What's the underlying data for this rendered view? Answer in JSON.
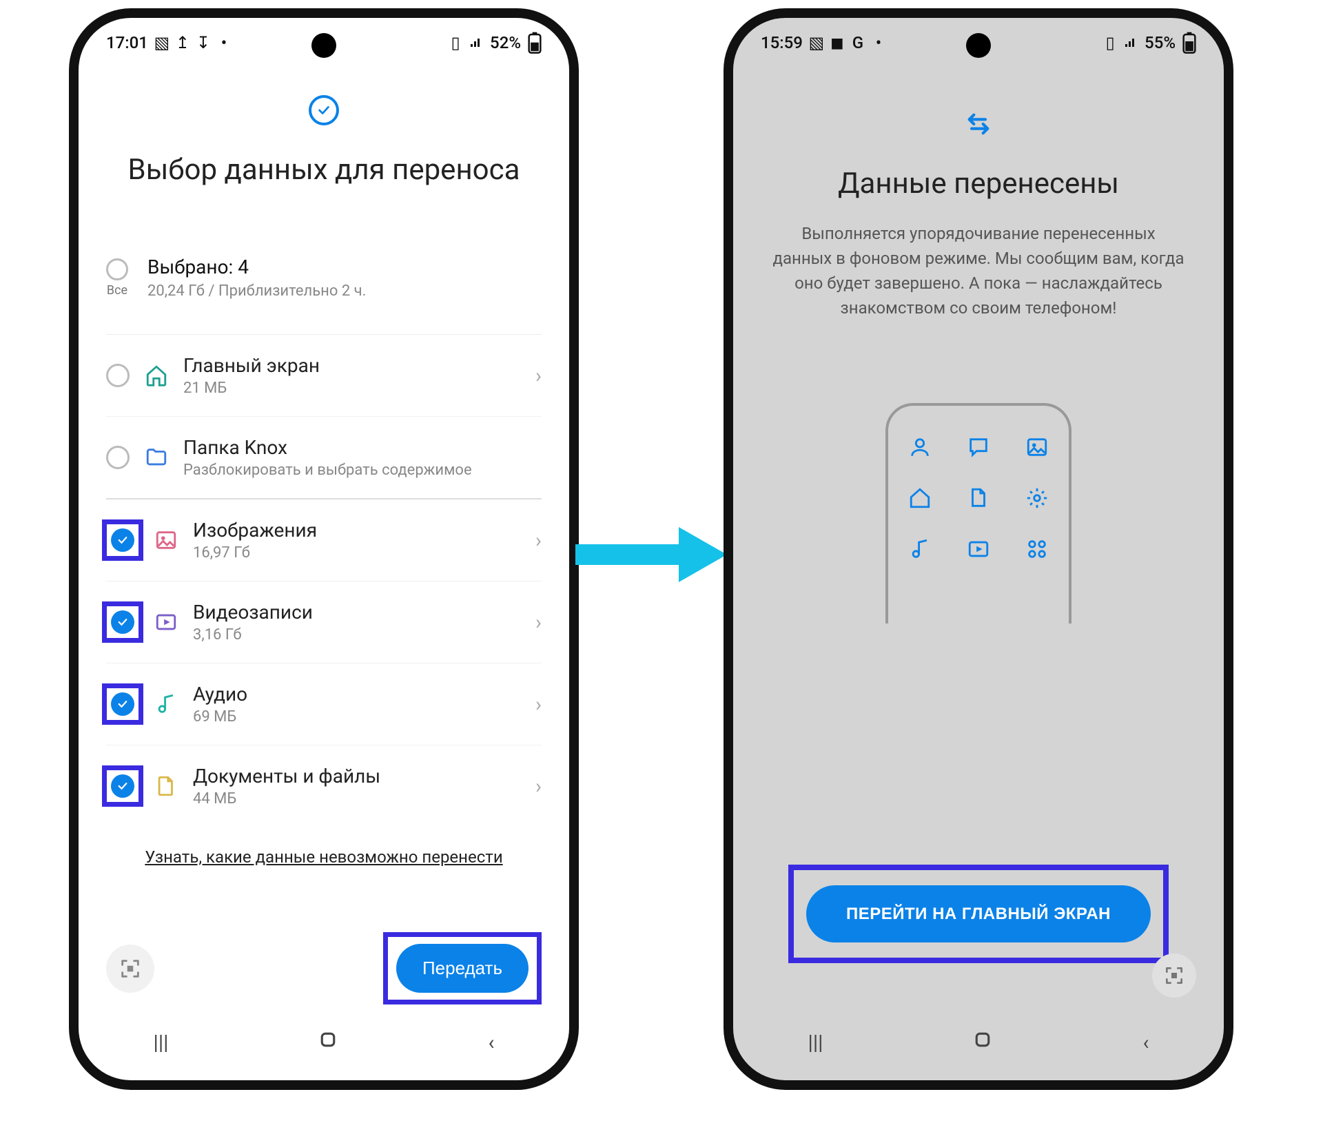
{
  "colors": {
    "accent": "#0b82e8",
    "highlight": "#3a2be0",
    "arrow": "#15c1e8"
  },
  "left": {
    "status": {
      "time": "17:01",
      "battery": "52%"
    },
    "title": "Выбор данных для переноса",
    "summary": {
      "all_label": "Все",
      "selected": "Выбрано: 4",
      "details": "20,24 Гб / Приблизительно 2 ч."
    },
    "items": [
      {
        "name": "Главный экран",
        "sub": "21 МБ",
        "checked": false,
        "highlighted": false,
        "icon": "home"
      },
      {
        "name": "Папка Knox",
        "sub": "Разблокировать и выбрать содержимое",
        "checked": false,
        "highlighted": false,
        "icon": "folder"
      },
      {
        "name": "Изображения",
        "sub": "16,97 Гб",
        "checked": true,
        "highlighted": true,
        "icon": "image"
      },
      {
        "name": "Видеозаписи",
        "sub": "3,16 Гб",
        "checked": true,
        "highlighted": true,
        "icon": "video"
      },
      {
        "name": "Аудио",
        "sub": "69 МБ",
        "checked": true,
        "highlighted": true,
        "icon": "audio"
      },
      {
        "name": "Документы и файлы",
        "sub": "44 МБ",
        "checked": true,
        "highlighted": true,
        "icon": "document"
      }
    ],
    "link": "Узнать, какие данные невозможно перенести",
    "send_button": "Передать"
  },
  "right": {
    "status": {
      "time": "15:59",
      "battery": "55%"
    },
    "title": "Данные перенесены",
    "description": "Выполняется упорядочивание перенесенных данных в фоновом режиме. Мы сообщим вам, когда оно будет завершено. А пока — наслаждайтесь знакомством со своим телефоном!",
    "goto_button": "ПЕРЕЙТИ НА ГЛАВНЫЙ ЭКРАН"
  }
}
